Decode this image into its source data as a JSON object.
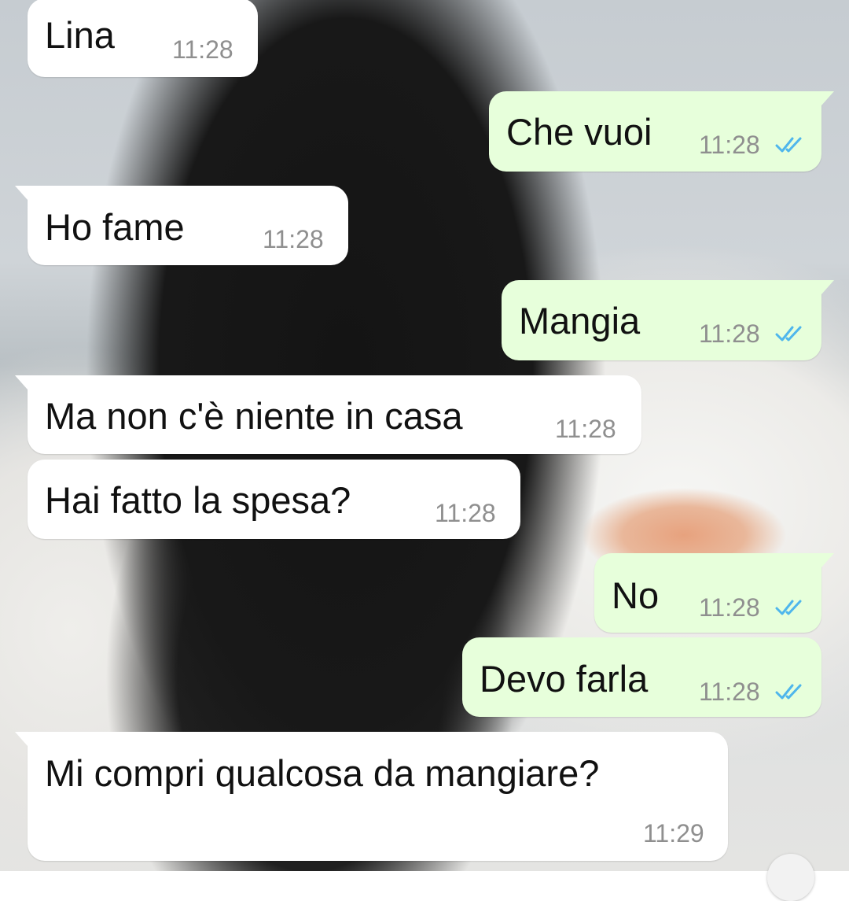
{
  "chat": {
    "messages": [
      {
        "direction": "incoming",
        "text": "Lina",
        "time": "11:28"
      },
      {
        "direction": "outgoing",
        "text": "Che vuoi",
        "time": "11:28",
        "status_icon": "double-check-read-icon"
      },
      {
        "direction": "incoming",
        "text": "Ho fame",
        "time": "11:28"
      },
      {
        "direction": "outgoing",
        "text": "Mangia",
        "time": "11:28",
        "status_icon": "double-check-read-icon"
      },
      {
        "direction": "incoming",
        "text": "Ma non c'è niente in casa",
        "time": "11:28"
      },
      {
        "direction": "incoming",
        "text": "Hai fatto la spesa?",
        "time": "11:28"
      },
      {
        "direction": "outgoing",
        "text": "No",
        "time": "11:28",
        "status_icon": "double-check-read-icon"
      },
      {
        "direction": "outgoing",
        "text": "Devo farla",
        "time": "11:28",
        "status_icon": "double-check-read-icon"
      },
      {
        "direction": "incoming",
        "text": "Mi compri qualcosa da mangiare?",
        "time": "11:29"
      }
    ]
  },
  "colors": {
    "incoming_bubble": "#ffffff",
    "outgoing_bubble": "#e7ffdb",
    "read_tick": "#4fb6ec",
    "timestamp": "#8f8f8f"
  }
}
